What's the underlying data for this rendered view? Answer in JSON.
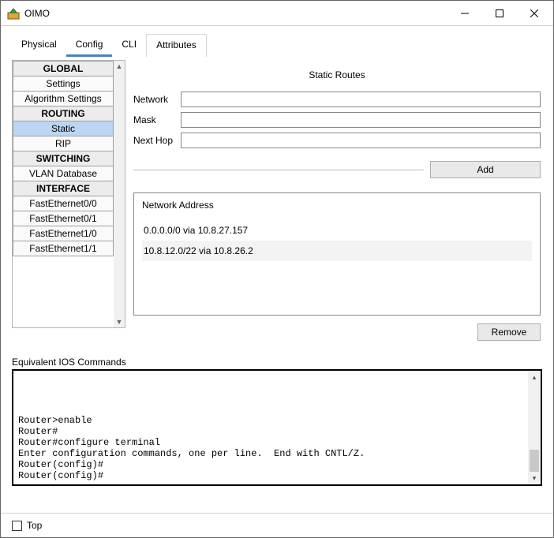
{
  "window": {
    "title": "OIMO"
  },
  "tabs": [
    "Physical",
    "Config",
    "CLI",
    "Attributes"
  ],
  "active_tab_index": 1,
  "current_tab_index": 3,
  "sidebar": {
    "sections": [
      {
        "header": "GLOBAL",
        "items": [
          "Settings",
          "Algorithm Settings"
        ]
      },
      {
        "header": "ROUTING",
        "items": [
          "Static",
          "RIP"
        ]
      },
      {
        "header": "SWITCHING",
        "items": [
          "VLAN Database"
        ]
      },
      {
        "header": "INTERFACE",
        "items": [
          "FastEthernet0/0",
          "FastEthernet0/1",
          "FastEthernet1/0",
          "FastEthernet1/1"
        ]
      }
    ],
    "selected": "Static"
  },
  "pane": {
    "title": "Static Routes",
    "fields": {
      "network_label": "Network",
      "mask_label": "Mask",
      "nexthop_label": "Next Hop",
      "network_value": "",
      "mask_value": "",
      "nexthop_value": ""
    },
    "add_label": "Add",
    "list_header": "Network Address",
    "routes": [
      "0.0.0.0/0 via 10.8.27.157",
      "10.8.12.0/22 via 10.8.26.2"
    ],
    "selected_route_index": 1,
    "remove_label": "Remove"
  },
  "ios": {
    "label": "Equivalent IOS Commands",
    "lines": [
      "",
      "",
      "Router>enable",
      "Router#",
      "Router#configure terminal",
      "Enter configuration commands, one per line.  End with CNTL/Z.",
      "Router(config)#",
      "Router(config)#"
    ]
  },
  "footer": {
    "top_label": "Top",
    "top_checked": false
  }
}
